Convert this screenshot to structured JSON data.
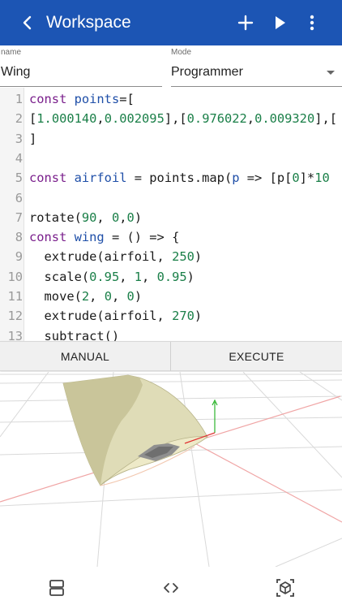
{
  "appbar": {
    "title": "Workspace",
    "icons": [
      "back-arrow-icon",
      "add-icon",
      "play-icon",
      "more-vert-icon"
    ],
    "color": "#1c55b4"
  },
  "form": {
    "name_label": "name",
    "name_value": "Wing",
    "mode_label": "Mode",
    "mode_value": "Programmer"
  },
  "editor": {
    "lines": [
      {
        "num": "1",
        "parts": [
          [
            "kw",
            "const "
          ],
          [
            "vr",
            "points"
          ],
          [
            "p",
            "=["
          ]
        ]
      },
      {
        "num": "2",
        "parts": [
          [
            "p",
            "["
          ],
          [
            "nm",
            "1.000140"
          ],
          [
            "p",
            ","
          ],
          [
            "nm",
            "0.002095"
          ],
          [
            "p",
            "],["
          ],
          [
            "nm",
            "0.976022"
          ],
          [
            "p",
            ","
          ],
          [
            "nm",
            "0.009320"
          ],
          [
            "p",
            "],["
          ]
        ]
      },
      {
        "num": "3",
        "parts": [
          [
            "p",
            "]"
          ]
        ]
      },
      {
        "num": "4",
        "parts": []
      },
      {
        "num": "5",
        "parts": [
          [
            "kw",
            "const "
          ],
          [
            "vr",
            "airfoil"
          ],
          [
            "p",
            " = points.map("
          ],
          [
            "vr",
            "p"
          ],
          [
            "p",
            " => [p["
          ],
          [
            "nm",
            "0"
          ],
          [
            "p",
            "]*"
          ],
          [
            "nm",
            "10"
          ]
        ]
      },
      {
        "num": "6",
        "parts": []
      },
      {
        "num": "7",
        "parts": [
          [
            "p",
            "rotate("
          ],
          [
            "nm",
            "90"
          ],
          [
            "p",
            ", "
          ],
          [
            "nm",
            "0"
          ],
          [
            "p",
            ","
          ],
          [
            "nm",
            "0"
          ],
          [
            "p",
            ")"
          ]
        ]
      },
      {
        "num": "8",
        "parts": [
          [
            "kw",
            "const "
          ],
          [
            "vr",
            "wing"
          ],
          [
            "p",
            " = () => {"
          ]
        ]
      },
      {
        "num": "9",
        "parts": [
          [
            "p",
            "  extrude(airfoil, "
          ],
          [
            "nm",
            "250"
          ],
          [
            "p",
            ")"
          ]
        ]
      },
      {
        "num": "10",
        "parts": [
          [
            "p",
            "  scale("
          ],
          [
            "nm",
            "0.95"
          ],
          [
            "p",
            ", "
          ],
          [
            "nm",
            "1"
          ],
          [
            "p",
            ", "
          ],
          [
            "nm",
            "0.95"
          ],
          [
            "p",
            ")"
          ]
        ]
      },
      {
        "num": "11",
        "parts": [
          [
            "p",
            "  move("
          ],
          [
            "nm",
            "2"
          ],
          [
            "p",
            ", "
          ],
          [
            "nm",
            "0"
          ],
          [
            "p",
            ", "
          ],
          [
            "nm",
            "0"
          ],
          [
            "p",
            ")"
          ]
        ]
      },
      {
        "num": "12",
        "parts": [
          [
            "p",
            "  extrude(airfoil, "
          ],
          [
            "nm",
            "270"
          ],
          [
            "p",
            ")"
          ]
        ]
      },
      {
        "num": "13",
        "parts": [
          [
            "p",
            "  subtract()"
          ]
        ]
      }
    ]
  },
  "buttons": {
    "manual": "MANUAL",
    "execute": "EXECUTE"
  },
  "bottom_nav": {
    "icons": [
      "split-view-icon",
      "code-icon",
      "3d-view-icon"
    ]
  }
}
